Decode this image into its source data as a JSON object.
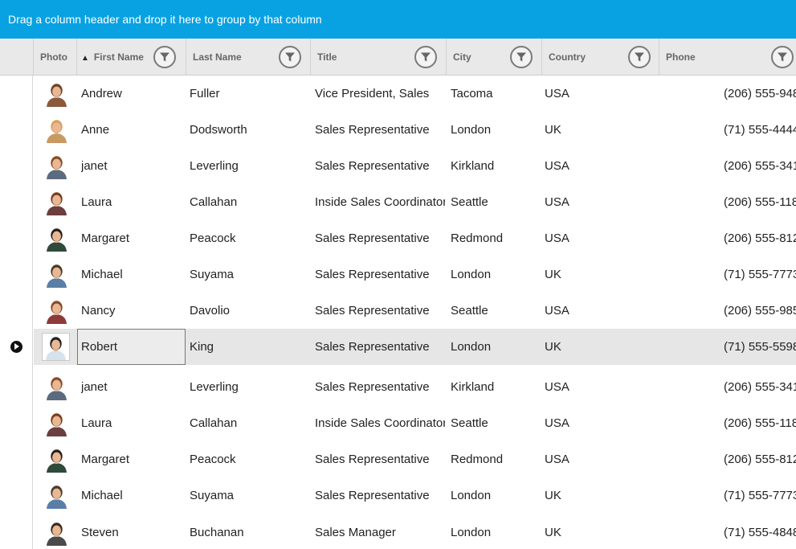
{
  "group_panel": {
    "text": "Drag a column header and drop it here to group by that column"
  },
  "columns": [
    {
      "key": "photo",
      "label": "Photo"
    },
    {
      "key": "first_name",
      "label": "First Name",
      "sorted": "ascending"
    },
    {
      "key": "last_name",
      "label": "Last Name"
    },
    {
      "key": "title",
      "label": "Title"
    },
    {
      "key": "city",
      "label": "City"
    },
    {
      "key": "country",
      "label": "Country"
    },
    {
      "key": "phone",
      "label": "Phone"
    }
  ],
  "rows": [
    {
      "photo": "person-photo-icon",
      "first_name": "Andrew",
      "last_name": "Fuller",
      "title": "Vice President, Sales",
      "city": "Tacoma",
      "country": "USA",
      "phone": "(206) 555-948"
    },
    {
      "photo": "person-photo-icon",
      "first_name": "Anne",
      "last_name": "Dodsworth",
      "title": "Sales Representative",
      "city": "London",
      "country": "UK",
      "phone": "(71) 555-4444"
    },
    {
      "photo": "person-photo-icon",
      "first_name": "janet",
      "last_name": "Leverling",
      "title": "Sales Representative",
      "city": "Kirkland",
      "country": "USA",
      "phone": "(206) 555-341"
    },
    {
      "photo": "person-photo-icon",
      "first_name": "Laura",
      "last_name": "Callahan",
      "title": "Inside Sales Coordinator",
      "city": "Seattle",
      "country": "USA",
      "phone": "(206) 555-118"
    },
    {
      "photo": "person-photo-icon",
      "first_name": "Margaret",
      "last_name": "Peacock",
      "title": "Sales Representative",
      "city": "Redmond",
      "country": "USA",
      "phone": "(206) 555-812"
    },
    {
      "photo": "person-photo-icon",
      "first_name": "Michael",
      "last_name": "Suyama",
      "title": "Sales Representative",
      "city": "London",
      "country": "UK",
      "phone": "(71) 555-7773"
    },
    {
      "photo": "person-photo-icon",
      "first_name": "Nancy",
      "last_name": "Davolio",
      "title": "Sales Representative",
      "city": "Seattle",
      "country": "USA",
      "phone": "(206) 555-985"
    },
    {
      "photo": "person-photo-icon",
      "first_name": "Robert",
      "last_name": "King",
      "title": "Sales Representative",
      "city": "London",
      "country": "UK",
      "phone": "(71) 555-5598",
      "selected": true
    },
    {
      "photo": "person-photo-icon",
      "first_name": "janet",
      "last_name": "Leverling",
      "title": "Sales Representative",
      "city": "Kirkland",
      "country": "USA",
      "phone": "(206) 555-341"
    },
    {
      "photo": "person-photo-icon",
      "first_name": "Laura",
      "last_name": "Callahan",
      "title": "Inside Sales Coordinator",
      "city": "Seattle",
      "country": "USA",
      "phone": "(206) 555-118"
    },
    {
      "photo": "person-photo-icon",
      "first_name": "Margaret",
      "last_name": "Peacock",
      "title": "Sales Representative",
      "city": "Redmond",
      "country": "USA",
      "phone": "(206) 555-812"
    },
    {
      "photo": "person-photo-icon",
      "first_name": "Michael",
      "last_name": "Suyama",
      "title": "Sales Representative",
      "city": "London",
      "country": "UK",
      "phone": "(71) 555-7773"
    },
    {
      "photo": "person-photo-icon",
      "first_name": "Steven",
      "last_name": "Buchanan",
      "title": "Sales Manager",
      "city": "London",
      "country": "UK",
      "phone": "(71) 555-4848"
    }
  ],
  "colors": {
    "group_panel": "#08a2e3",
    "header_bg": "#e9e9e9",
    "selected_row": "#e6e6e6"
  },
  "icons": {
    "filter": "filter-funnel-icon",
    "sort": "sort-ascending-icon",
    "row_indicator": "current-row-indicator-icon"
  }
}
